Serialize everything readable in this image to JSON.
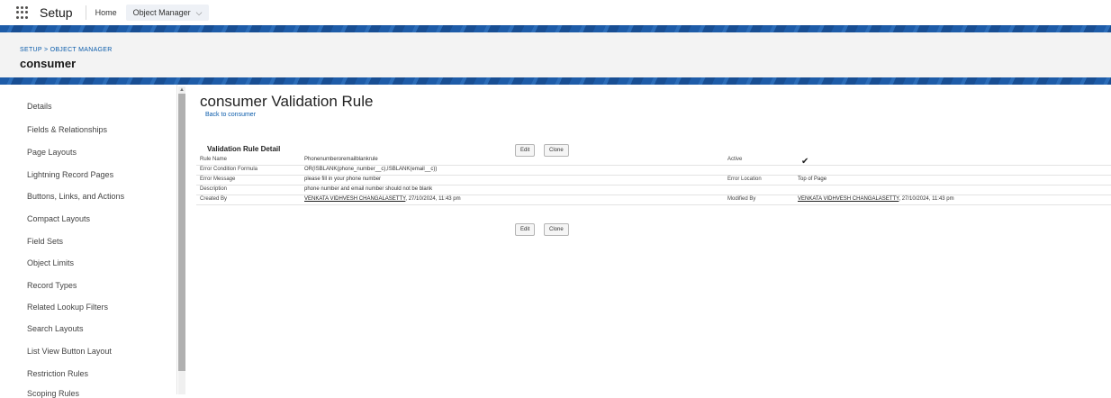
{
  "topnav": {
    "app_name": "Setup",
    "home": "Home",
    "object_manager": "Object Manager"
  },
  "header": {
    "breadcrumb": "SETUP > OBJECT MANAGER",
    "title": "consumer"
  },
  "sidebar": {
    "items": [
      {
        "label": "Details"
      },
      {
        "label": "Fields & Relationships"
      },
      {
        "label": "Page Layouts"
      },
      {
        "label": "Lightning Record Pages"
      },
      {
        "label": "Buttons, Links, and Actions"
      },
      {
        "label": "Compact Layouts"
      },
      {
        "label": "Field Sets"
      },
      {
        "label": "Object Limits"
      },
      {
        "label": "Record Types"
      },
      {
        "label": "Related Lookup Filters"
      },
      {
        "label": "Search Layouts"
      },
      {
        "label": "List View Button Layout"
      },
      {
        "label": "Restriction Rules"
      },
      {
        "label": "Scoping Rules"
      }
    ]
  },
  "main": {
    "title": "consumer Validation Rule",
    "back_link": "Back to consumer",
    "section_label": "Validation Rule Detail",
    "edit_label": "Edit",
    "clone_label": "Clone",
    "rows": {
      "rule_name": {
        "label": "Rule Name",
        "value": "Phonenumberoremailblankrule"
      },
      "active": {
        "label": "Active",
        "value": "✔"
      },
      "formula": {
        "label": "Error Condition Formula",
        "value": "OR(ISBLANK(phone_number__c),ISBLANK(email__c))"
      },
      "message": {
        "label": "Error Message",
        "value": "please fill in your phone number"
      },
      "location": {
        "label": "Error Location",
        "value": "Top of Page"
      },
      "description": {
        "label": "Description",
        "value": "phone number and email number should not be blank"
      },
      "created_by": {
        "label": "Created By",
        "user": "VENKATA VIDHVESH CHANGALASETTY",
        "date": ", 27/10/2024, 11:43 pm"
      },
      "modified_by": {
        "label": "Modified By",
        "user": "VENKATA VIDHVESH CHANGALASETTY",
        "date": ", 27/10/2024, 11:43 pm"
      }
    }
  }
}
